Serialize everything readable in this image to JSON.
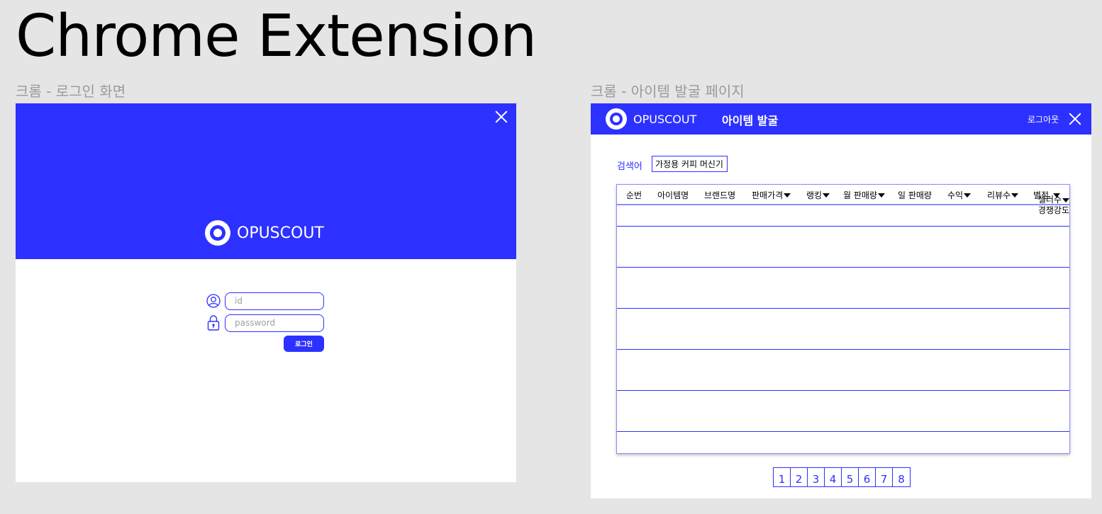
{
  "page": {
    "title": "Chrome Extension"
  },
  "colors": {
    "brand_blue": "#2d31ff",
    "canvas": "#e5e5e5"
  },
  "login_screen": {
    "frame_label": "크롬 - 로그인 화면",
    "brand_name": "OPUSCOUT",
    "id_placeholder": "id",
    "password_placeholder": "password",
    "login_button": "로그인",
    "icons": {
      "close": "close-icon",
      "user": "user-icon",
      "lock": "lock-icon",
      "logo": "logo-icon"
    }
  },
  "item_screen": {
    "frame_label": "크롬 - 아이템 발굴 페이지",
    "brand_name": "OPUSCOUT",
    "header_title": "아이템 발굴",
    "logout_label": "로그아웃",
    "search_label": "검색어",
    "search_value": "가정용 커피 머신기",
    "columns": [
      {
        "label": "순번"
      },
      {
        "label": "아이템명"
      },
      {
        "label": "브랜드명"
      },
      {
        "label": "판매가격"
      },
      {
        "label": "랭킹"
      },
      {
        "label": "월 판매량"
      },
      {
        "label": "일 판매량"
      },
      {
        "label": "수익"
      },
      {
        "label": "리뷰수"
      },
      {
        "label": "별점"
      }
    ],
    "wrapped_columns": [
      "셀러수",
      "경쟁강도"
    ],
    "pages": [
      "1",
      "2",
      "3",
      "4",
      "5",
      "6",
      "7",
      "8"
    ]
  }
}
